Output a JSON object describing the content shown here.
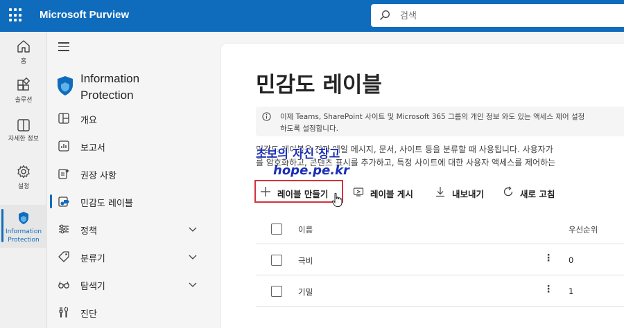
{
  "header": {
    "app_title": "Microsoft Purview",
    "search_placeholder": "검색"
  },
  "rail": {
    "items": [
      {
        "label": "홈",
        "icon": "home-icon"
      },
      {
        "label": "솔루션",
        "icon": "solutions-icon"
      },
      {
        "label": "자세한 정보",
        "icon": "book-icon"
      },
      {
        "label": "설정",
        "icon": "gear-icon"
      },
      {
        "label": "Information Protection",
        "icon": "shield-icon"
      }
    ]
  },
  "nav": {
    "section_title_line1": "Information",
    "section_title_line2": "Protection",
    "items": [
      {
        "label": "개요",
        "icon": "overview-icon"
      },
      {
        "label": "보고서",
        "icon": "chart-icon"
      },
      {
        "label": "권장 사항",
        "icon": "recommendation-icon"
      },
      {
        "label": "민감도 레이블",
        "icon": "label-icon",
        "active": true
      },
      {
        "label": "정책",
        "icon": "sliders-icon",
        "expandable": true
      },
      {
        "label": "분류기",
        "icon": "tag-icon",
        "expandable": true
      },
      {
        "label": "탐색기",
        "icon": "glasses-icon",
        "expandable": true
      },
      {
        "label": "진단",
        "icon": "tools-icon"
      }
    ]
  },
  "main": {
    "title": "민감도 레이블",
    "info_line1": "이제 Teams, SharePoint 사이트 및 Microsoft 365 그룹의 개인 정보 와도 있는 액세스 제어 설정",
    "info_line2": "하도록 설정합니다.",
    "desc_line1": "민감도 레이블은 전자 메일 메시지, 문서, 사이트 등을 분류할 때 사용됩니다. 사용자가",
    "desc_line2": "를 암호화하고, 콘텐츠 표시를 추가하고, 특정 사이트에 대한 사용자 액세스를 제어하는",
    "watermark_line1": "초보의 자신 창고",
    "watermark_line2": "hope.pe.kr",
    "toolbar": {
      "create": "레이블 만들기",
      "publish": "레이블 게시",
      "export": "내보내기",
      "refresh": "새로 고침"
    },
    "table": {
      "col_name": "이름",
      "col_priority": "우선순위",
      "rows": [
        {
          "name": "극비",
          "priority": "0"
        },
        {
          "name": "기밀",
          "priority": "1"
        }
      ]
    }
  },
  "colors": {
    "brand": "#0f6cbd",
    "highlight": "#d13438",
    "watermark": "#1a2fb5"
  }
}
